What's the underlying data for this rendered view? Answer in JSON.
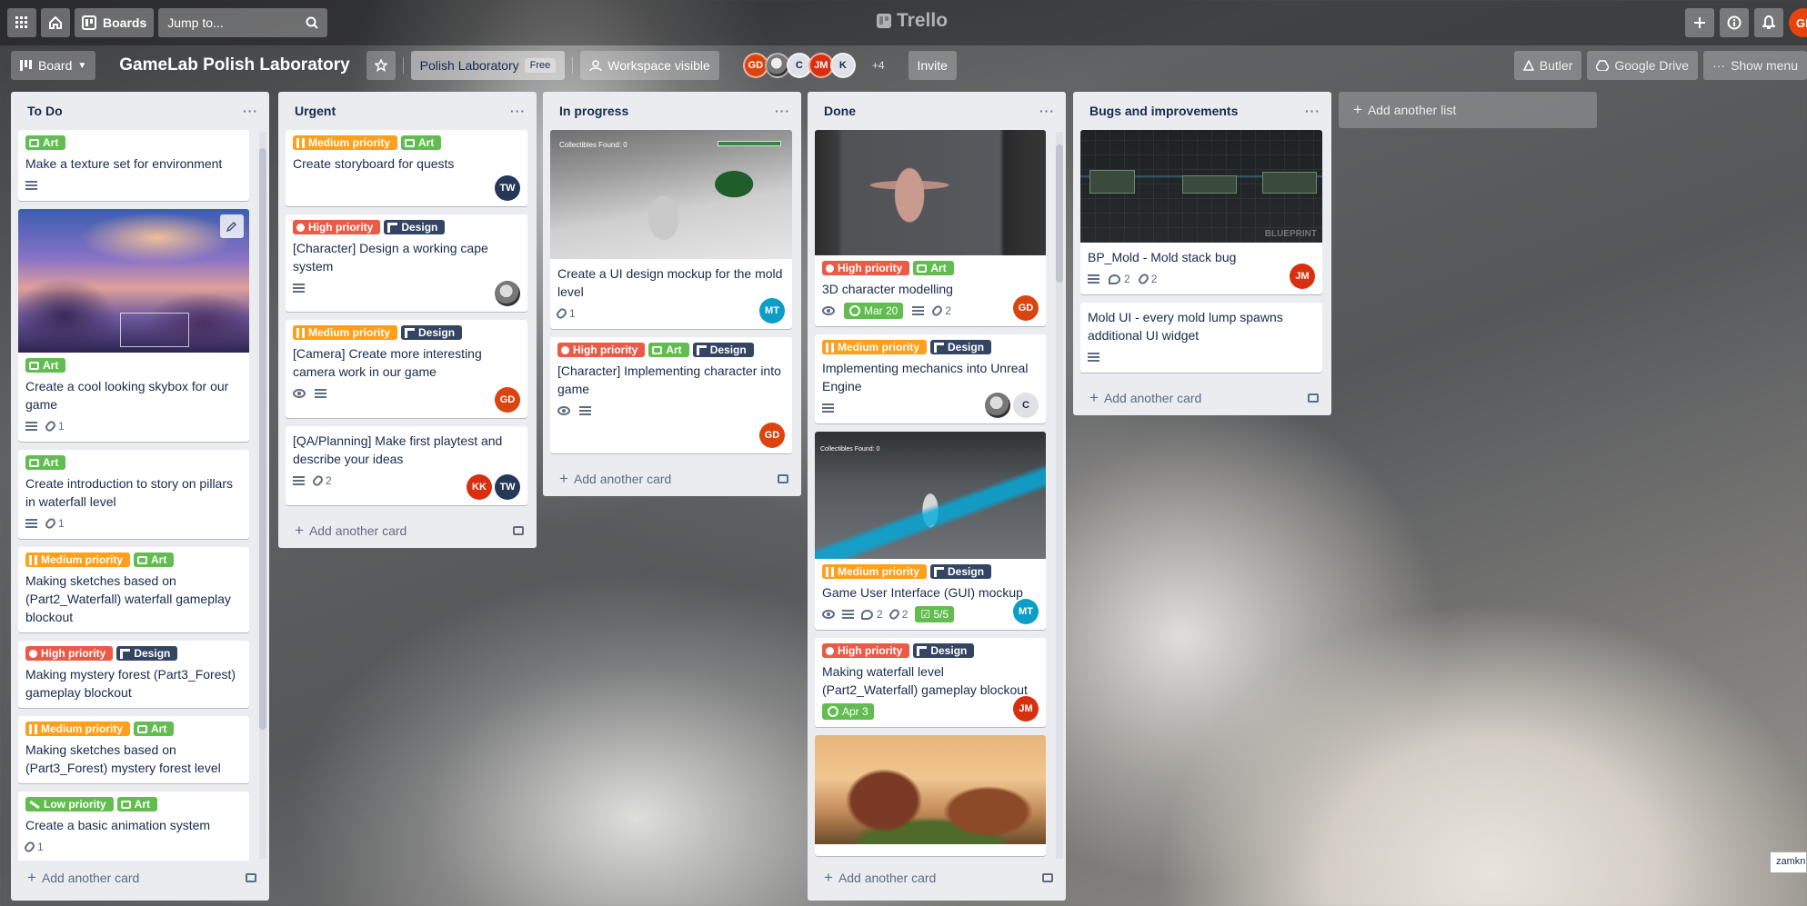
{
  "header": {
    "boards_label": "Boards",
    "search_placeholder": "Jump to...",
    "logo": "Trello",
    "icons": [
      "apps-grid-icon",
      "home-icon",
      "board-icon",
      "search-icon",
      "plus-icon",
      "info-icon",
      "bell-icon"
    ],
    "user_initials": "GD"
  },
  "board": {
    "view_label": "Board",
    "title": "GameLab Polish Laboratory",
    "workspace": "Polish Laboratory",
    "plan": "Free",
    "visibility": "Workspace visible",
    "members": [
      "GD",
      "C",
      "JM",
      "K"
    ],
    "more_members": "+4",
    "invite": "Invite",
    "butler": "Butler",
    "drive": "Google Drive",
    "menu": "Show menu"
  },
  "labels": {
    "art": "Art",
    "design": "Design",
    "high": "High priority",
    "medium": "Medium priority",
    "low": "Low priority"
  },
  "lists": [
    {
      "title": "To Do",
      "add": "Add another card",
      "cards": [
        {
          "title": "Make a texture set for environment",
          "desc": true
        },
        {
          "title": "Create a cool looking skybox for our game",
          "attach": "1"
        },
        {
          "title": "Create introduction to story on pillars in waterfall level",
          "attach": "1"
        },
        {
          "title": "Making sketches based on (Part2_Waterfall) waterfall gameplay blockout"
        },
        {
          "title": "Making mystery forest (Part3_Forest) gameplay blockout"
        },
        {
          "title": "Making sketches based on (Part3_Forest) mystery forest level"
        },
        {
          "title": "Create a basic animation system",
          "attach": "1"
        }
      ]
    },
    {
      "title": "Urgent",
      "add": "Add another card",
      "cards": [
        {
          "title": "Create storyboard for quests",
          "member": "TW"
        },
        {
          "title": "[Character] Design a working cape system"
        },
        {
          "title": "[Camera] Create more interesting camera work in our game",
          "member": "GD"
        },
        {
          "title": "[QA/Planning] Make first playtest and describe your ideas",
          "attach": "2",
          "members": [
            "KK",
            "TW"
          ]
        }
      ]
    },
    {
      "title": "In progress",
      "add": "Add another card",
      "cards": [
        {
          "title": "Create a UI design mockup for the mold level",
          "attach": "1",
          "member": "MT",
          "cover_text": "Collectibles Found: 0"
        },
        {
          "title": "[Character] Implementing character into game",
          "member": "GD"
        }
      ]
    },
    {
      "title": "Done",
      "add": "Add another card",
      "cards": [
        {
          "title": "3D character modelling",
          "due": "Mar 20",
          "attach": "2",
          "member": "GD"
        },
        {
          "title": "Implementing mechanics into Unreal Engine",
          "member2": "C"
        },
        {
          "title": "Game User Interface (GUI) mockup",
          "comments": "2",
          "attach": "2",
          "checklist": "5/5",
          "member": "MT",
          "cover_text": "Collectibles Found: 0"
        },
        {
          "title": "Making waterfall level (Part2_Waterfall) gameplay blockout",
          "due": "Apr 3",
          "member": "JM"
        }
      ]
    },
    {
      "title": "Bugs and improvements",
      "add": "Add another card",
      "cards": [
        {
          "title": "BP_Mold - Mold stack bug",
          "comments": "2",
          "attach": "2",
          "member": "JM",
          "cover_text": "BLUEPRINT"
        },
        {
          "title": "Mold UI - every mold lump spawns additional UI widget"
        }
      ]
    }
  ],
  "add_list": "Add another list",
  "tooltip": "zamknij",
  "colors": {
    "art": "#61bd4f",
    "high": "#eb5a46",
    "medium": "#ff9f1a",
    "low": "#61bd4f",
    "design": "#344563",
    "list_bg": "#ebecf0"
  }
}
